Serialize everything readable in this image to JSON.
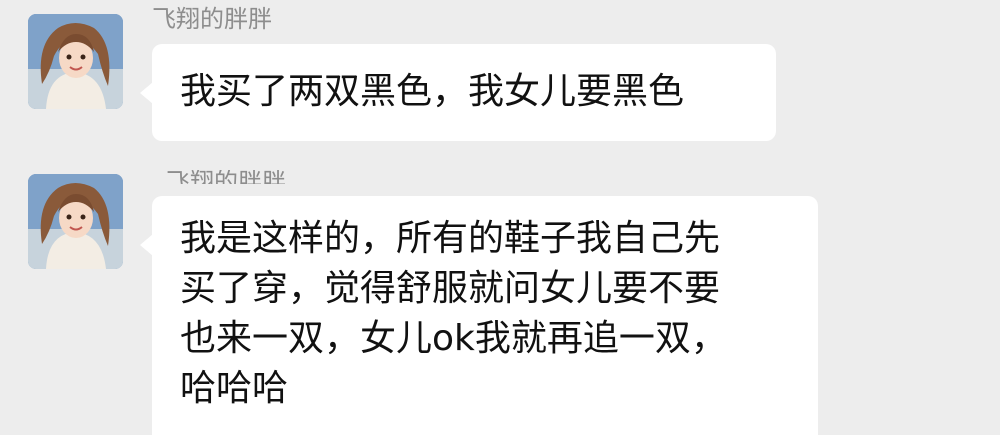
{
  "messages": [
    {
      "sender": "飞翔的胖胖",
      "lines": [
        "我买了两双黑色，我女儿要黑色"
      ]
    },
    {
      "sender": "飞翔的胖胖",
      "lines": [
        "我是这样的，所有的鞋子我自己先",
        "买了穿，觉得舒服就问女儿要不要",
        "也来一双，女儿ok我就再追一双，",
        "哈哈哈"
      ]
    }
  ]
}
